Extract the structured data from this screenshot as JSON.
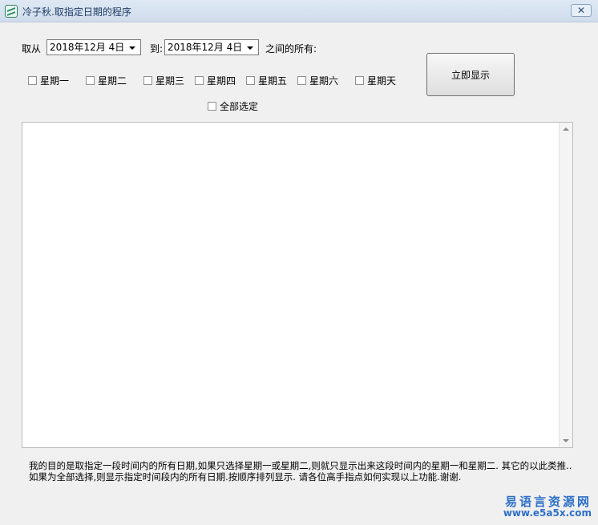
{
  "window": {
    "title": "冷子秋.取指定日期的程序",
    "close_symbol": "✕"
  },
  "range": {
    "from_label": "取从",
    "from_date": "2018年12月  4日",
    "to_label": "到:",
    "to_date": "2018年12月  4日",
    "suffix_label": "之间的所有:"
  },
  "weekdays": [
    {
      "label": "星期一",
      "checked": false
    },
    {
      "label": "星期二",
      "checked": false
    },
    {
      "label": "星期三",
      "checked": false
    },
    {
      "label": "星期四",
      "checked": false
    },
    {
      "label": "星期五",
      "checked": false
    },
    {
      "label": "星期六",
      "checked": false
    },
    {
      "label": "星期天",
      "checked": false
    }
  ],
  "select_all": {
    "label": "全部选定",
    "checked": false
  },
  "show_button": {
    "label": "立即显示"
  },
  "description": "我的目的是取指定一段时间内的所有日期,如果只选择星期一或星期二,则就只显示出来这段时间内的星期一和星期二.  其它的以此类推..如果为全部选择,则显示指定时间段内的所有日期.按顺序排列显示.  请各位高手指点如何实现以上功能.谢谢.",
  "watermark": {
    "line1": "易语言资源网",
    "line2": "www.e5a5x.com"
  }
}
